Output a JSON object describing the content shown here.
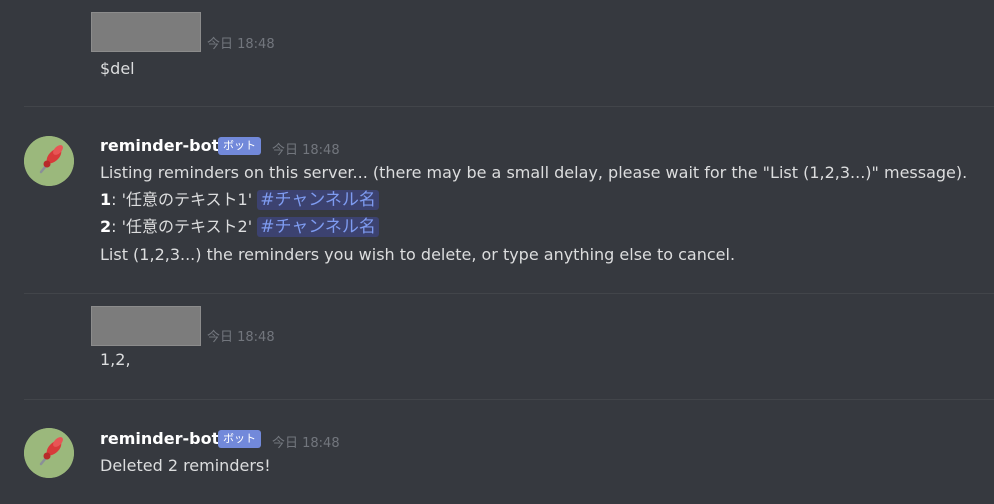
{
  "messages": [
    {
      "timestamp": "今日 18:48",
      "text": "$del"
    },
    {
      "author": "reminder-bot",
      "badge": "ボット",
      "timestamp": "今日 18:48",
      "line1": "Listing reminders on this server... (there may be a small delay, please wait for the \"List (1,2,3...)\" message).",
      "items": [
        {
          "num": "1",
          "text": ": '任意のテキスト1' ",
          "channel": "#チャンネル名"
        },
        {
          "num": "2",
          "text": ": '任意のテキスト2' ",
          "channel": "#チャンネル名"
        }
      ],
      "line_last": "List (1,2,3...) the reminders you wish to delete, or type anything else to cancel."
    },
    {
      "timestamp": "今日 18:48",
      "text": "1,2,"
    },
    {
      "author": "reminder-bot",
      "badge": "ボット",
      "timestamp": "今日 18:48",
      "text": "Deleted 2 reminders!"
    }
  ],
  "colors": {
    "background": "#36393f",
    "bot_badge": "#7289da",
    "mention_text": "#7e9bf0",
    "mention_bg": "#3c4270"
  },
  "icons": {
    "bot_avatar": "pushpin-icon"
  }
}
